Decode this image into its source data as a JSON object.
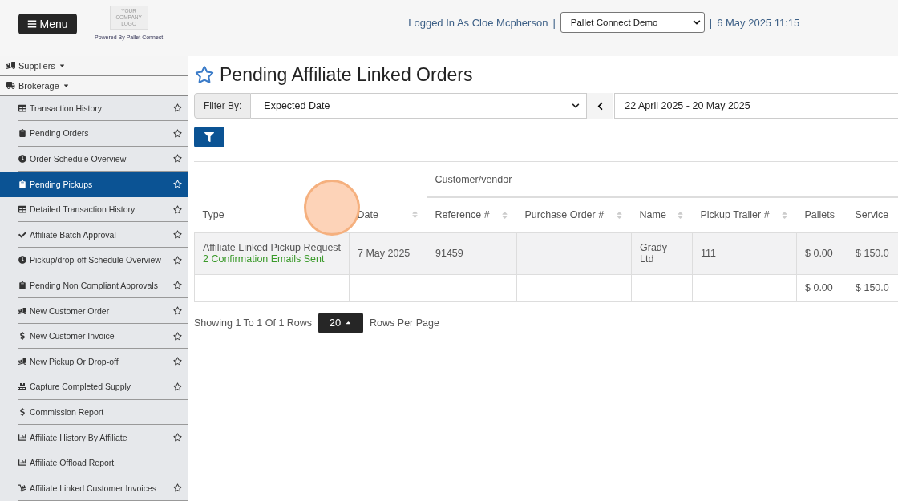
{
  "header": {
    "menu_button": "Menu",
    "logo_text": "YOUR COMPANY LOGO",
    "powered_by": "Powered By Pallet Connect",
    "logged_in": "Logged In As Cloe Mcpherson",
    "separator_left": "|",
    "company_select": "Pallet Connect Demo",
    "separator_right": "|",
    "datetime": "6 May 2025 11:15"
  },
  "sidebar": {
    "groups": [
      {
        "label": "Suppliers",
        "kind": "truck-loading"
      },
      {
        "label": "Brokerage",
        "kind": "truck"
      }
    ],
    "items": [
      {
        "label": "Transaction History",
        "kind": "table",
        "star": true,
        "selected": false
      },
      {
        "label": "Pending Orders",
        "kind": "clipboard",
        "star": true,
        "selected": false
      },
      {
        "label": "Order Schedule Overview",
        "kind": "clock",
        "star": true,
        "selected": false
      },
      {
        "label": "Pending Pickups",
        "kind": "clipboard",
        "star": true,
        "selected": true
      },
      {
        "label": "Detailed Transaction History",
        "kind": "table",
        "star": true,
        "selected": false
      },
      {
        "label": "Affiliate Batch Approval",
        "kind": "check",
        "star": true,
        "selected": false
      },
      {
        "label": "Pickup/drop-off Schedule Overview",
        "kind": "clock",
        "star": true,
        "selected": false
      },
      {
        "label": "Pending Non Compliant Approvals",
        "kind": "clipboard",
        "star": true,
        "selected": false
      },
      {
        "label": "New Customer Order",
        "kind": "truck-loading",
        "star": true,
        "selected": false
      },
      {
        "label": "New Customer Invoice",
        "kind": "dollar",
        "star": true,
        "selected": false
      },
      {
        "label": "New Pickup Or Drop-off",
        "kind": "truck-loading",
        "star": true,
        "selected": false
      },
      {
        "label": "Capture Completed Supply",
        "kind": "pallet",
        "star": true,
        "selected": false
      },
      {
        "label": "Commission Report",
        "kind": "dollar",
        "star": false,
        "selected": false
      },
      {
        "label": "Affiliate History By Affiliate",
        "kind": "chart",
        "star": true,
        "selected": false
      },
      {
        "label": "Affiliate Offload Report",
        "kind": "chart",
        "star": false,
        "selected": false
      },
      {
        "label": "Affiliate Linked Customer Invoices",
        "kind": "dolly",
        "star": true,
        "selected": false
      }
    ]
  },
  "page": {
    "title": "Pending Affiliate Linked Orders",
    "filter_label": "Filter By:",
    "filter_value": "Expected Date",
    "date_range": "22 April 2025 - 20 May 2025"
  },
  "table": {
    "group_header": "Customer/vendor",
    "columns": [
      {
        "label": "Type",
        "sortable": false
      },
      {
        "label": "Date",
        "sortable": true
      },
      {
        "label": "Reference #",
        "sortable": true
      },
      {
        "label": "Purchase Order #",
        "sortable": true
      },
      {
        "label": "Name",
        "sortable": true
      },
      {
        "label": "Pickup Trailer #",
        "sortable": true
      },
      {
        "label": "Pallets",
        "sortable": false
      },
      {
        "label": "Service",
        "sortable": false
      }
    ],
    "rows": [
      {
        "type": "Affiliate Linked Pickup Request",
        "note": "2 Confirmation Emails Sent",
        "date": "7 May 2025",
        "reference": "91459",
        "purchase_order": "",
        "name": "Grady Ltd",
        "trailer": "111",
        "pallets": "$ 0.00",
        "services": "$ 150.0"
      }
    ],
    "totals": {
      "pallets": "$ 0.00",
      "services": "$ 150.0"
    }
  },
  "pagination": {
    "showing": "Showing 1 To 1 Of 1 Rows",
    "page_size": "20",
    "suffix": "Rows Per Page"
  }
}
